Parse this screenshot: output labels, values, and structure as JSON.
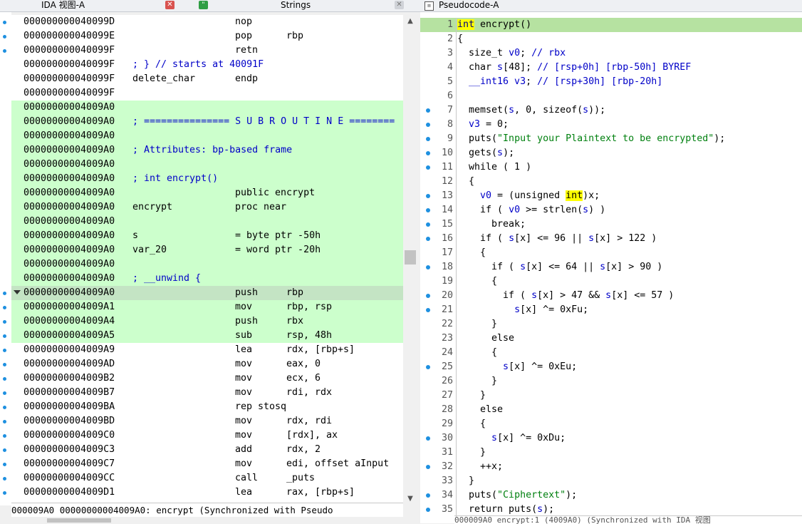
{
  "tabs": {
    "ida_view": "IDA 视图-A",
    "strings": "Strings",
    "pseudocode": "Pseudocode-A",
    "close_glyph": "✕"
  },
  "disasm": {
    "rows": [
      {
        "addr": "000000000040099D",
        "label": "",
        "mn": "nop",
        "op": "",
        "green": false,
        "comment": ""
      },
      {
        "addr": "000000000040099E",
        "label": "",
        "mn": "pop",
        "op": "rbp",
        "green": false,
        "comment": ""
      },
      {
        "addr": "000000000040099F",
        "label": "",
        "mn": "retn",
        "op": "",
        "green": false,
        "comment": ""
      },
      {
        "addr": "000000000040099F",
        "label": "",
        "mn": "",
        "op": "",
        "green": false,
        "comment": "; } // starts at 40091F"
      },
      {
        "addr": "000000000040099F",
        "label": "delete_char",
        "mn": "endp",
        "op": "",
        "green": false,
        "comment": ""
      },
      {
        "addr": "000000000040099F",
        "label": "",
        "mn": "",
        "op": "",
        "green": false,
        "comment": ""
      },
      {
        "addr": "00000000004009A0",
        "label": "",
        "mn": "",
        "op": "",
        "green": true,
        "comment": ""
      },
      {
        "addr": "00000000004009A0",
        "label": "",
        "mn": "",
        "op": "",
        "green": true,
        "comment": "; =============== S U B R O U T I N E ========"
      },
      {
        "addr": "00000000004009A0",
        "label": "",
        "mn": "",
        "op": "",
        "green": true,
        "comment": ""
      },
      {
        "addr": "00000000004009A0",
        "label": "",
        "mn": "",
        "op": "",
        "green": true,
        "comment": "; Attributes: bp-based frame"
      },
      {
        "addr": "00000000004009A0",
        "label": "",
        "mn": "",
        "op": "",
        "green": true,
        "comment": ""
      },
      {
        "addr": "00000000004009A0",
        "label": "",
        "mn": "",
        "op": "",
        "green": true,
        "comment": "; int encrypt()"
      },
      {
        "addr": "00000000004009A0",
        "label": "",
        "mn": "public encrypt",
        "op": "",
        "green": true,
        "comment": ""
      },
      {
        "addr": "00000000004009A0",
        "label": "encrypt",
        "mn": "proc near",
        "op": "",
        "green": true,
        "comment": ""
      },
      {
        "addr": "00000000004009A0",
        "label": "",
        "mn": "",
        "op": "",
        "green": true,
        "comment": ""
      },
      {
        "addr": "00000000004009A0",
        "label": "s",
        "mn": "= byte ptr -50h",
        "op": "",
        "green": true,
        "comment": ""
      },
      {
        "addr": "00000000004009A0",
        "label": "var_20",
        "mn": "= word ptr -20h",
        "op": "",
        "green": true,
        "comment": ""
      },
      {
        "addr": "00000000004009A0",
        "label": "",
        "mn": "",
        "op": "",
        "green": true,
        "comment": ""
      },
      {
        "addr": "00000000004009A0",
        "label": "",
        "mn": "",
        "op": "",
        "green": true,
        "comment": "; __unwind {"
      },
      {
        "addr": "00000000004009A0",
        "label": "",
        "mn": "push",
        "op": "rbp",
        "green": true,
        "comment": "",
        "sel": true
      },
      {
        "addr": "00000000004009A1",
        "label": "",
        "mn": "mov",
        "op": "rbp, rsp",
        "green": true,
        "comment": ""
      },
      {
        "addr": "00000000004009A4",
        "label": "",
        "mn": "push",
        "op": "rbx",
        "green": true,
        "comment": ""
      },
      {
        "addr": "00000000004009A5",
        "label": "",
        "mn": "sub",
        "op": "rsp, 48h",
        "green": true,
        "comment": ""
      },
      {
        "addr": "00000000004009A9",
        "label": "",
        "mn": "lea",
        "op": "rdx, [rbp+s]",
        "green": false,
        "comment": ""
      },
      {
        "addr": "00000000004009AD",
        "label": "",
        "mn": "mov",
        "op": "eax, 0",
        "green": false,
        "comment": ""
      },
      {
        "addr": "00000000004009B2",
        "label": "",
        "mn": "mov",
        "op": "ecx, 6",
        "green": false,
        "comment": ""
      },
      {
        "addr": "00000000004009B7",
        "label": "",
        "mn": "mov",
        "op": "rdi, rdx",
        "green": false,
        "comment": ""
      },
      {
        "addr": "00000000004009BA",
        "label": "",
        "mn": "rep stosq",
        "op": "",
        "green": false,
        "comment": ""
      },
      {
        "addr": "00000000004009BD",
        "label": "",
        "mn": "mov",
        "op": "rdx, rdi",
        "green": false,
        "comment": ""
      },
      {
        "addr": "00000000004009C0",
        "label": "",
        "mn": "mov",
        "op": "[rdx], ax",
        "green": false,
        "comment": ""
      },
      {
        "addr": "00000000004009C3",
        "label": "",
        "mn": "add",
        "op": "rdx, 2",
        "green": false,
        "comment": ""
      },
      {
        "addr": "00000000004009C7",
        "label": "",
        "mn": "mov",
        "op": "edi, offset aInput",
        "green": false,
        "comment": ""
      },
      {
        "addr": "00000000004009CC",
        "label": "",
        "mn": "call",
        "op": "_puts",
        "green": false,
        "comment": ""
      },
      {
        "addr": "00000000004009D1",
        "label": "",
        "mn": "lea",
        "op": "rax, [rbp+s]",
        "green": false,
        "comment": ""
      }
    ],
    "status": "000009A0 00000000004009A0: encrypt (Synchronized with Pseudo"
  },
  "pseudocode": {
    "lines": [
      {
        "n": "1",
        "dot": false,
        "html": "<span class='ylw kw'>int</span> encrypt()"
      },
      {
        "n": "2",
        "dot": false,
        "html": "{"
      },
      {
        "n": "3",
        "dot": false,
        "html": "  size_t <span class='var'>v0</span>; <span class='cmt'>// rbx</span>"
      },
      {
        "n": "4",
        "dot": false,
        "html": "  char <span class='var'>s</span>[48]; <span class='cmt'>// [rsp+0h] [rbp-50h] BYREF</span>"
      },
      {
        "n": "5",
        "dot": false,
        "html": "  <span class='var'>__int16 v3</span>; <span class='cmt'>// [rsp+30h] [rbp-20h]</span>"
      },
      {
        "n": "6",
        "dot": false,
        "html": ""
      },
      {
        "n": "7",
        "dot": true,
        "html": "  memset(<span class='var'>s</span>, 0, sizeof(<span class='var'>s</span>));"
      },
      {
        "n": "8",
        "dot": true,
        "html": "  <span class='var'>v3</span> = 0;"
      },
      {
        "n": "9",
        "dot": true,
        "html": "  puts(<span class='str'>\"Input your Plaintext to be encrypted\"</span>);"
      },
      {
        "n": "10",
        "dot": true,
        "html": "  gets(<span class='var'>s</span>);"
      },
      {
        "n": "11",
        "dot": true,
        "html": "  while ( 1 )"
      },
      {
        "n": "12",
        "dot": false,
        "html": "  {"
      },
      {
        "n": "13",
        "dot": true,
        "html": "    <span class='var'>v0</span> = (unsigned <span class='ylw'>int</span>)x;"
      },
      {
        "n": "14",
        "dot": true,
        "html": "    if ( <span class='var'>v0</span> >= strlen(<span class='var'>s</span>) )"
      },
      {
        "n": "15",
        "dot": true,
        "html": "      break;"
      },
      {
        "n": "16",
        "dot": true,
        "html": "    if ( <span class='var'>s</span>[x] <= 96 || <span class='var'>s</span>[x] > 122 )"
      },
      {
        "n": "17",
        "dot": false,
        "html": "    {"
      },
      {
        "n": "18",
        "dot": true,
        "html": "      if ( <span class='var'>s</span>[x] <= 64 || <span class='var'>s</span>[x] > 90 )"
      },
      {
        "n": "19",
        "dot": false,
        "html": "      {"
      },
      {
        "n": "20",
        "dot": true,
        "html": "        if ( <span class='var'>s</span>[x] > 47 && <span class='var'>s</span>[x] <= 57 )"
      },
      {
        "n": "21",
        "dot": true,
        "html": "          <span class='var'>s</span>[x] ^= 0xFu;"
      },
      {
        "n": "22",
        "dot": false,
        "html": "      }"
      },
      {
        "n": "23",
        "dot": false,
        "html": "      else"
      },
      {
        "n": "24",
        "dot": false,
        "html": "      {"
      },
      {
        "n": "25",
        "dot": true,
        "html": "        <span class='var'>s</span>[x] ^= 0xEu;"
      },
      {
        "n": "26",
        "dot": false,
        "html": "      }"
      },
      {
        "n": "27",
        "dot": false,
        "html": "    }"
      },
      {
        "n": "28",
        "dot": false,
        "html": "    else"
      },
      {
        "n": "29",
        "dot": false,
        "html": "    {"
      },
      {
        "n": "30",
        "dot": true,
        "html": "      <span class='var'>s</span>[x] ^= 0xDu;"
      },
      {
        "n": "31",
        "dot": false,
        "html": "    }"
      },
      {
        "n": "32",
        "dot": true,
        "html": "    ++x;"
      },
      {
        "n": "33",
        "dot": false,
        "html": "  }"
      },
      {
        "n": "34",
        "dot": true,
        "html": "  puts(<span class='str'>\"Ciphertext\"</span>);"
      },
      {
        "n": "35",
        "dot": true,
        "html": "  return puts(<span class='var'>s</span>);"
      }
    ],
    "status": "000009A0 encrypt:1 (4009A0) (Synchronized with IDA 视图"
  }
}
